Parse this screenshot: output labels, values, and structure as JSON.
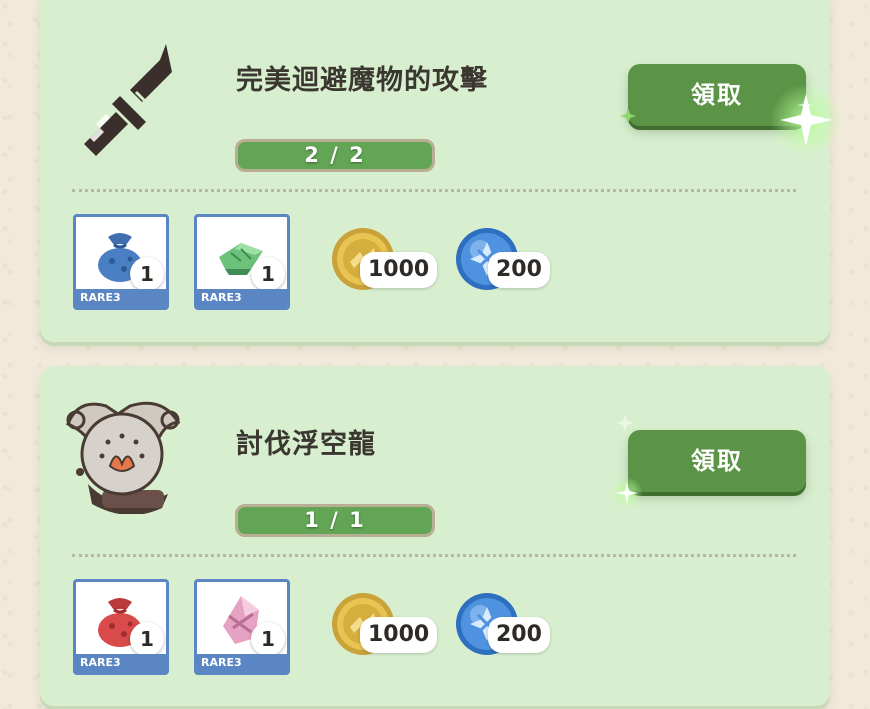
{
  "quests": [
    {
      "title": "完美迴避魔物的攻擊",
      "progress_text": "2 / 2",
      "progress_fraction": 1.0,
      "claim_label": "領取",
      "icon": "sword-icon",
      "rewards": {
        "items": [
          {
            "icon": "blue-pouch-icon",
            "count": "1",
            "rarity": "RARE3"
          },
          {
            "icon": "green-material-icon",
            "count": "1",
            "rarity": "RARE3"
          }
        ],
        "zenny": "1000",
        "points": "200"
      }
    },
    {
      "title": "討伐浮空龍",
      "progress_text": "1 / 1",
      "progress_fraction": 1.0,
      "claim_label": "領取",
      "icon": "monster-legiana-icon",
      "rewards": {
        "items": [
          {
            "icon": "red-pouch-icon",
            "count": "1",
            "rarity": "RARE3"
          },
          {
            "icon": "pink-material-icon",
            "count": "1",
            "rarity": "RARE3"
          }
        ],
        "zenny": "1000",
        "points": "200"
      }
    }
  ],
  "colors": {
    "card_bg": "#d8efcf",
    "button": "#5c9447",
    "progress_fill": "#62a655",
    "rarity_blue": "#5b86c4"
  }
}
